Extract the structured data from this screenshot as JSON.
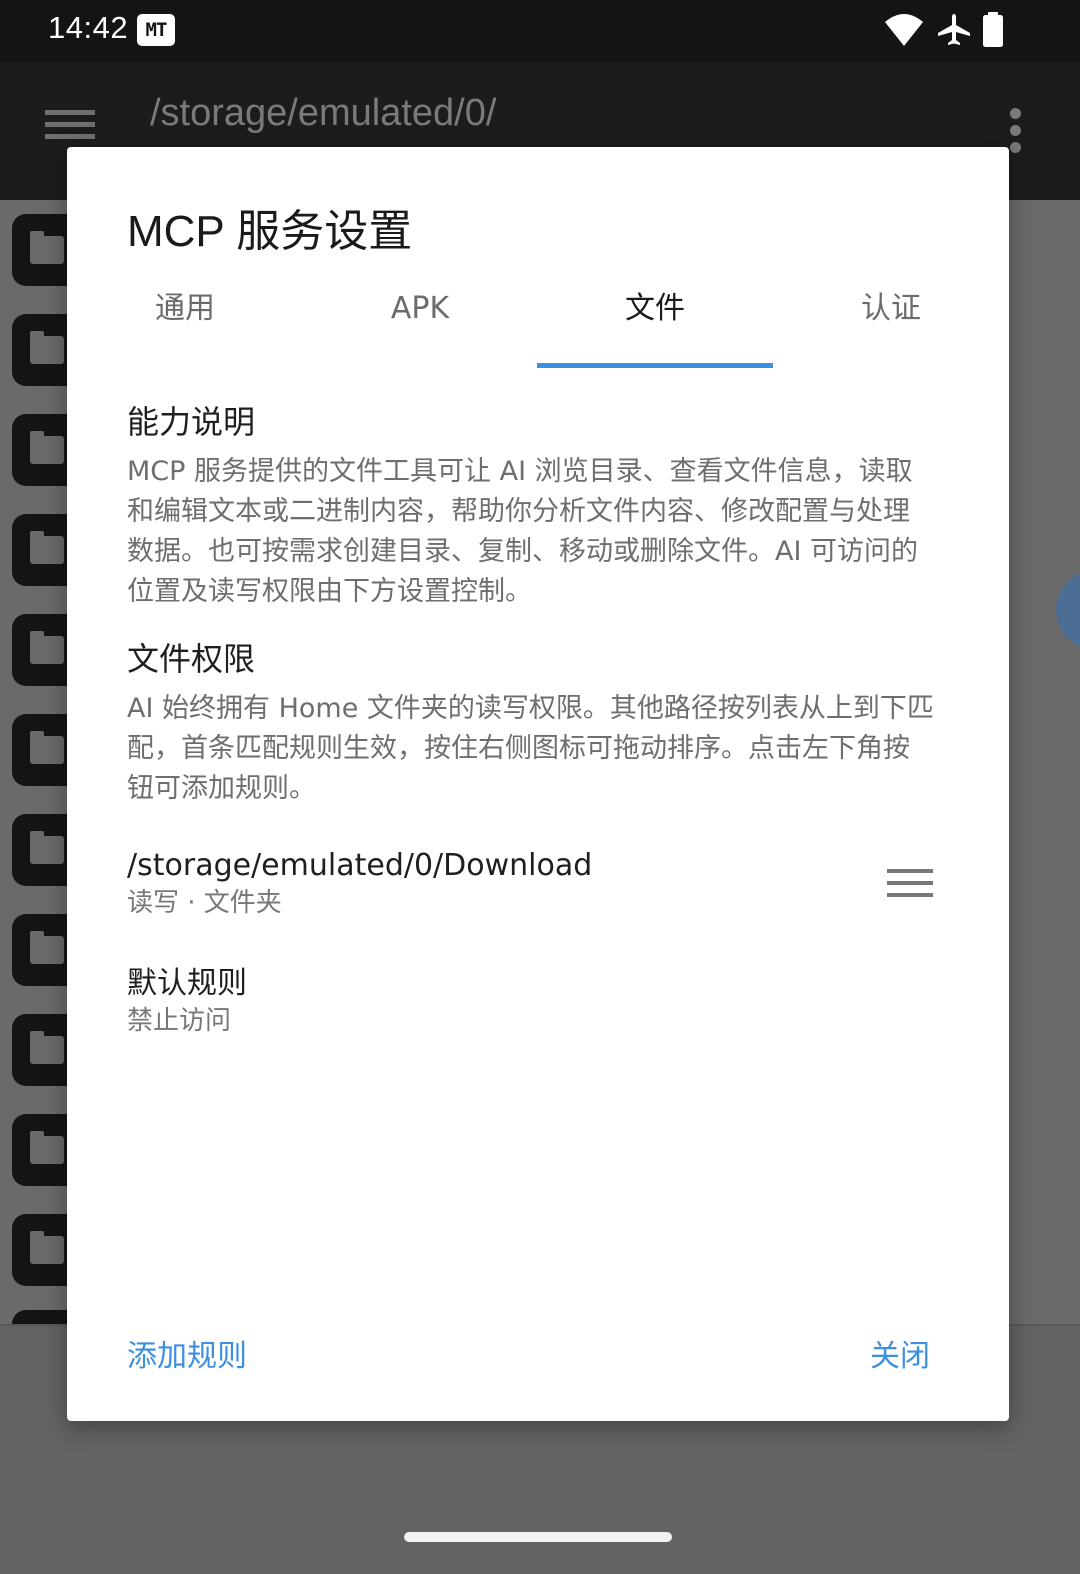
{
  "status_bar": {
    "time": "14:42",
    "notification_badge": "MT",
    "icons": [
      "wifi-icon",
      "airplane-icon",
      "battery-icon"
    ]
  },
  "app": {
    "toolbar_path": "/storage/emulated/0/",
    "toolbar_subtitle": "",
    "colors": {
      "toolbar": "#1c1c1c",
      "fab": "#4c6e94"
    }
  },
  "dialog": {
    "title": "MCP 服务设置",
    "tabs": [
      {
        "label": "通用",
        "active": false
      },
      {
        "label": "APK",
        "active": false
      },
      {
        "label": "文件",
        "active": true
      },
      {
        "label": "认证",
        "active": false
      }
    ],
    "accent_color": "#3d8fe0",
    "capability": {
      "heading": "能力说明",
      "lines": [
        "MCP 服务提供的文件工具可让 AI 浏览目录、查看文件信息，读取",
        "和编辑文本或二进制内容，帮助你分析文件内容、修改配置与处理",
        "数据。也可按需求创建目录、复制、移动或删除文件。AI 可访问的",
        "位置及读写权限由下方设置控制。"
      ]
    },
    "permissions": {
      "heading": "文件权限",
      "lines": [
        "AI 始终拥有 Home 文件夹的读写权限。其他路径按列表从上到下匹",
        "配，首条匹配规则生效，按住右侧图标可拖动排序。点击左下角按",
        "钮可添加规则。"
      ]
    },
    "rules": [
      {
        "path": "/storage/emulated/0/Download",
        "meta": "读写 · 文件夹"
      }
    ],
    "default_rule": {
      "title": "默认规则",
      "meta": "禁止访问"
    },
    "buttons": {
      "add_rule": "添加规则",
      "close": "关闭"
    }
  }
}
